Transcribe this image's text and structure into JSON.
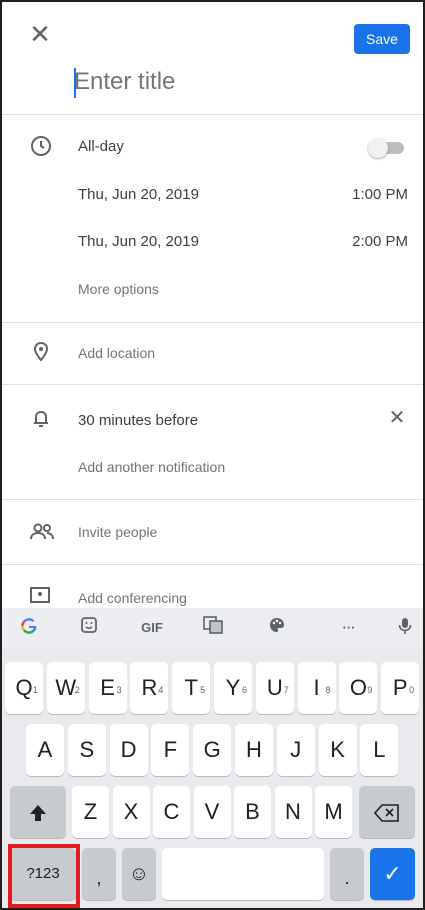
{
  "header": {
    "save_label": "Save",
    "title_placeholder": "Enter title"
  },
  "allday": {
    "label": "All-day",
    "toggle_on": false
  },
  "start": {
    "date": "Thu, Jun 20, 2019",
    "time": "1:00 PM"
  },
  "end": {
    "date": "Thu, Jun 20, 2019",
    "time": "2:00 PM"
  },
  "more_options": "More options",
  "location": {
    "label": "Add location"
  },
  "notification": {
    "label": "30 minutes before",
    "add_another": "Add another notification"
  },
  "invite": {
    "label": "Invite people"
  },
  "conferencing": {
    "label": "Add conferencing"
  },
  "keyboard": {
    "suggestion_icons": [
      "google-icon",
      "sticker-icon",
      "gif-icon",
      "translate-icon",
      "palette-icon",
      "more-icon",
      "mic-icon"
    ],
    "gif_label": "GIF",
    "more_label": "···",
    "row1": [
      {
        "key": "Q",
        "hint": "1"
      },
      {
        "key": "W",
        "hint": "2"
      },
      {
        "key": "E",
        "hint": "3"
      },
      {
        "key": "R",
        "hint": "4"
      },
      {
        "key": "T",
        "hint": "5"
      },
      {
        "key": "Y",
        "hint": "6"
      },
      {
        "key": "U",
        "hint": "7"
      },
      {
        "key": "I",
        "hint": "8"
      },
      {
        "key": "O",
        "hint": "9"
      },
      {
        "key": "P",
        "hint": "0"
      }
    ],
    "row2": [
      "A",
      "S",
      "D",
      "F",
      "G",
      "H",
      "J",
      "K",
      "L"
    ],
    "row3": [
      "Z",
      "X",
      "C",
      "V",
      "B",
      "N",
      "M"
    ],
    "symbols_label": "?123",
    "comma": ",",
    "period": ".",
    "emoji_glyph": "☺",
    "enter_glyph": "✓"
  },
  "colors": {
    "accent": "#1a73e8",
    "highlight": "#e21c1c"
  }
}
